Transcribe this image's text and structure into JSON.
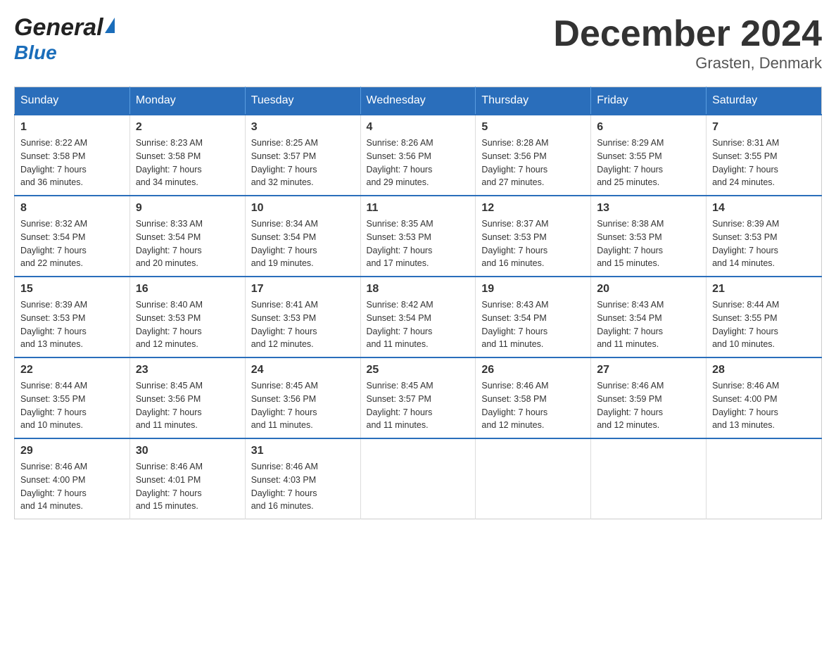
{
  "header": {
    "logo_general": "General",
    "logo_blue": "Blue",
    "month_title": "December 2024",
    "location": "Grasten, Denmark"
  },
  "days_of_week": [
    "Sunday",
    "Monday",
    "Tuesday",
    "Wednesday",
    "Thursday",
    "Friday",
    "Saturday"
  ],
  "weeks": [
    [
      {
        "day": "1",
        "sunrise": "Sunrise: 8:22 AM",
        "sunset": "Sunset: 3:58 PM",
        "daylight": "Daylight: 7 hours",
        "daylight2": "and 36 minutes."
      },
      {
        "day": "2",
        "sunrise": "Sunrise: 8:23 AM",
        "sunset": "Sunset: 3:58 PM",
        "daylight": "Daylight: 7 hours",
        "daylight2": "and 34 minutes."
      },
      {
        "day": "3",
        "sunrise": "Sunrise: 8:25 AM",
        "sunset": "Sunset: 3:57 PM",
        "daylight": "Daylight: 7 hours",
        "daylight2": "and 32 minutes."
      },
      {
        "day": "4",
        "sunrise": "Sunrise: 8:26 AM",
        "sunset": "Sunset: 3:56 PM",
        "daylight": "Daylight: 7 hours",
        "daylight2": "and 29 minutes."
      },
      {
        "day": "5",
        "sunrise": "Sunrise: 8:28 AM",
        "sunset": "Sunset: 3:56 PM",
        "daylight": "Daylight: 7 hours",
        "daylight2": "and 27 minutes."
      },
      {
        "day": "6",
        "sunrise": "Sunrise: 8:29 AM",
        "sunset": "Sunset: 3:55 PM",
        "daylight": "Daylight: 7 hours",
        "daylight2": "and 25 minutes."
      },
      {
        "day": "7",
        "sunrise": "Sunrise: 8:31 AM",
        "sunset": "Sunset: 3:55 PM",
        "daylight": "Daylight: 7 hours",
        "daylight2": "and 24 minutes."
      }
    ],
    [
      {
        "day": "8",
        "sunrise": "Sunrise: 8:32 AM",
        "sunset": "Sunset: 3:54 PM",
        "daylight": "Daylight: 7 hours",
        "daylight2": "and 22 minutes."
      },
      {
        "day": "9",
        "sunrise": "Sunrise: 8:33 AM",
        "sunset": "Sunset: 3:54 PM",
        "daylight": "Daylight: 7 hours",
        "daylight2": "and 20 minutes."
      },
      {
        "day": "10",
        "sunrise": "Sunrise: 8:34 AM",
        "sunset": "Sunset: 3:54 PM",
        "daylight": "Daylight: 7 hours",
        "daylight2": "and 19 minutes."
      },
      {
        "day": "11",
        "sunrise": "Sunrise: 8:35 AM",
        "sunset": "Sunset: 3:53 PM",
        "daylight": "Daylight: 7 hours",
        "daylight2": "and 17 minutes."
      },
      {
        "day": "12",
        "sunrise": "Sunrise: 8:37 AM",
        "sunset": "Sunset: 3:53 PM",
        "daylight": "Daylight: 7 hours",
        "daylight2": "and 16 minutes."
      },
      {
        "day": "13",
        "sunrise": "Sunrise: 8:38 AM",
        "sunset": "Sunset: 3:53 PM",
        "daylight": "Daylight: 7 hours",
        "daylight2": "and 15 minutes."
      },
      {
        "day": "14",
        "sunrise": "Sunrise: 8:39 AM",
        "sunset": "Sunset: 3:53 PM",
        "daylight": "Daylight: 7 hours",
        "daylight2": "and 14 minutes."
      }
    ],
    [
      {
        "day": "15",
        "sunrise": "Sunrise: 8:39 AM",
        "sunset": "Sunset: 3:53 PM",
        "daylight": "Daylight: 7 hours",
        "daylight2": "and 13 minutes."
      },
      {
        "day": "16",
        "sunrise": "Sunrise: 8:40 AM",
        "sunset": "Sunset: 3:53 PM",
        "daylight": "Daylight: 7 hours",
        "daylight2": "and 12 minutes."
      },
      {
        "day": "17",
        "sunrise": "Sunrise: 8:41 AM",
        "sunset": "Sunset: 3:53 PM",
        "daylight": "Daylight: 7 hours",
        "daylight2": "and 12 minutes."
      },
      {
        "day": "18",
        "sunrise": "Sunrise: 8:42 AM",
        "sunset": "Sunset: 3:54 PM",
        "daylight": "Daylight: 7 hours",
        "daylight2": "and 11 minutes."
      },
      {
        "day": "19",
        "sunrise": "Sunrise: 8:43 AM",
        "sunset": "Sunset: 3:54 PM",
        "daylight": "Daylight: 7 hours",
        "daylight2": "and 11 minutes."
      },
      {
        "day": "20",
        "sunrise": "Sunrise: 8:43 AM",
        "sunset": "Sunset: 3:54 PM",
        "daylight": "Daylight: 7 hours",
        "daylight2": "and 11 minutes."
      },
      {
        "day": "21",
        "sunrise": "Sunrise: 8:44 AM",
        "sunset": "Sunset: 3:55 PM",
        "daylight": "Daylight: 7 hours",
        "daylight2": "and 10 minutes."
      }
    ],
    [
      {
        "day": "22",
        "sunrise": "Sunrise: 8:44 AM",
        "sunset": "Sunset: 3:55 PM",
        "daylight": "Daylight: 7 hours",
        "daylight2": "and 10 minutes."
      },
      {
        "day": "23",
        "sunrise": "Sunrise: 8:45 AM",
        "sunset": "Sunset: 3:56 PM",
        "daylight": "Daylight: 7 hours",
        "daylight2": "and 11 minutes."
      },
      {
        "day": "24",
        "sunrise": "Sunrise: 8:45 AM",
        "sunset": "Sunset: 3:56 PM",
        "daylight": "Daylight: 7 hours",
        "daylight2": "and 11 minutes."
      },
      {
        "day": "25",
        "sunrise": "Sunrise: 8:45 AM",
        "sunset": "Sunset: 3:57 PM",
        "daylight": "Daylight: 7 hours",
        "daylight2": "and 11 minutes."
      },
      {
        "day": "26",
        "sunrise": "Sunrise: 8:46 AM",
        "sunset": "Sunset: 3:58 PM",
        "daylight": "Daylight: 7 hours",
        "daylight2": "and 12 minutes."
      },
      {
        "day": "27",
        "sunrise": "Sunrise: 8:46 AM",
        "sunset": "Sunset: 3:59 PM",
        "daylight": "Daylight: 7 hours",
        "daylight2": "and 12 minutes."
      },
      {
        "day": "28",
        "sunrise": "Sunrise: 8:46 AM",
        "sunset": "Sunset: 4:00 PM",
        "daylight": "Daylight: 7 hours",
        "daylight2": "and 13 minutes."
      }
    ],
    [
      {
        "day": "29",
        "sunrise": "Sunrise: 8:46 AM",
        "sunset": "Sunset: 4:00 PM",
        "daylight": "Daylight: 7 hours",
        "daylight2": "and 14 minutes."
      },
      {
        "day": "30",
        "sunrise": "Sunrise: 8:46 AM",
        "sunset": "Sunset: 4:01 PM",
        "daylight": "Daylight: 7 hours",
        "daylight2": "and 15 minutes."
      },
      {
        "day": "31",
        "sunrise": "Sunrise: 8:46 AM",
        "sunset": "Sunset: 4:03 PM",
        "daylight": "Daylight: 7 hours",
        "daylight2": "and 16 minutes."
      },
      null,
      null,
      null,
      null
    ]
  ]
}
